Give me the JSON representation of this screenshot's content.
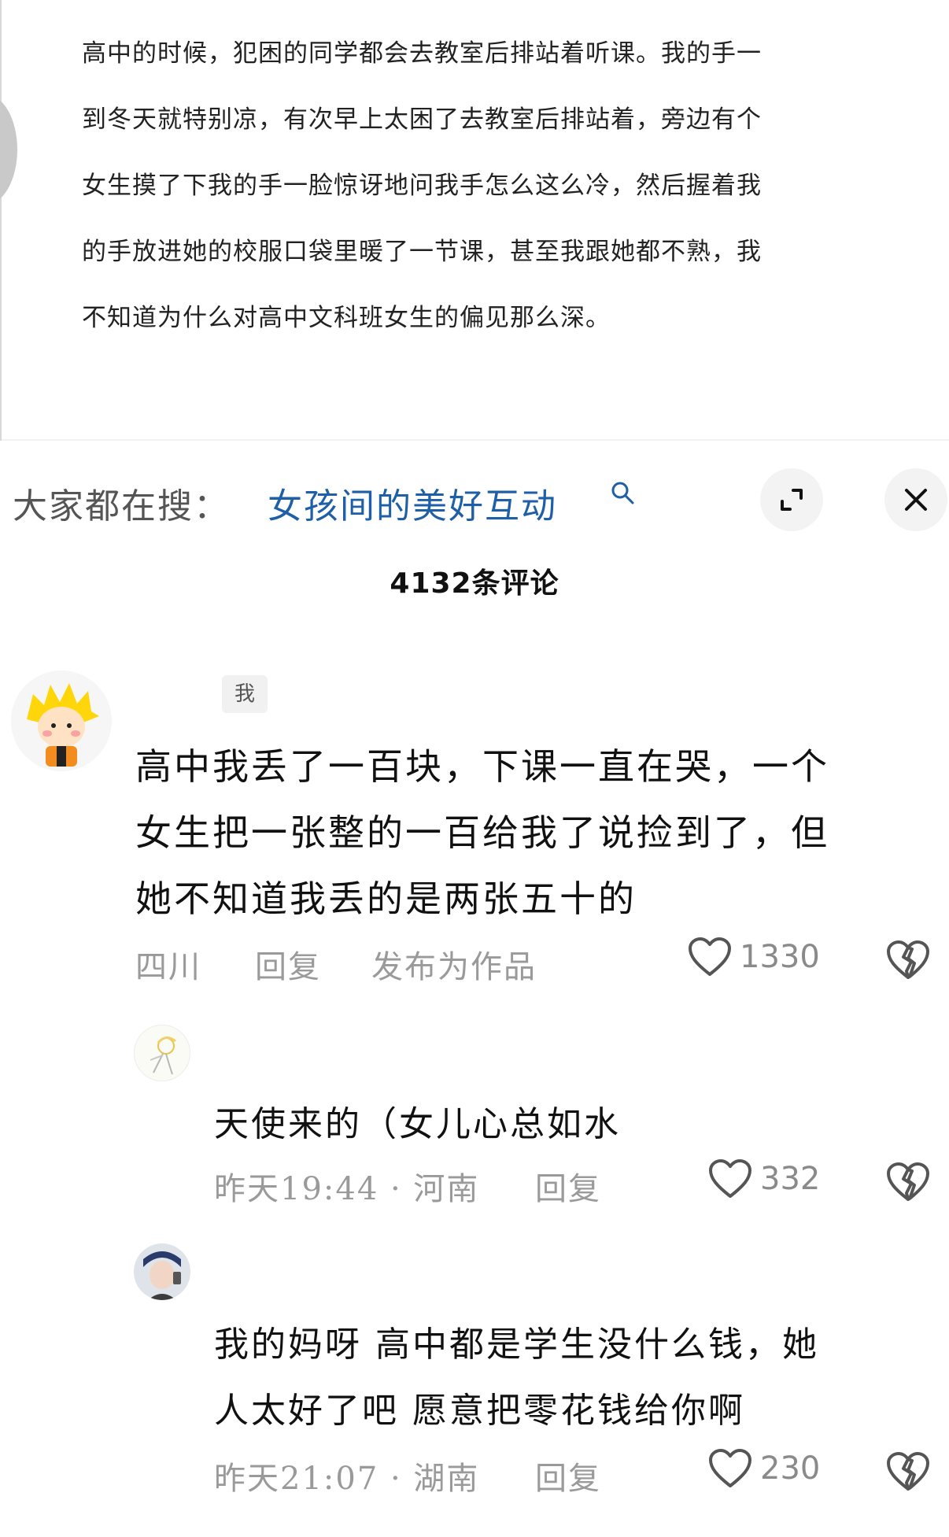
{
  "post": {
    "lines": [
      "高中的时候，犯困的同学都会去教室后排站着听课。我的手一",
      "到冬天就特别凉，有次早上太困了去教室后排站着，旁边有个",
      "女生摸了下我的手一脸惊讶地问我手怎么这么冷，然后握着我",
      "的手放进她的校服口袋里暖了一节课，甚至我跟她都不熟，我",
      "不知道为什么对高中文科班女生的偏见那么深。"
    ]
  },
  "search": {
    "prefix": "大家都在搜：",
    "term": "女孩间的美好互动",
    "icon": "search-icon"
  },
  "comments_header": {
    "count_label": "4132条评论"
  },
  "comments": [
    {
      "author_tag": "我",
      "avatar": "cartoon-avatar",
      "lines": [
        "高中我丢了一百块，下课一直在哭，一个",
        "女生把一张整的一百给我了说捡到了，但",
        "她不知道我丢的是两张五十的"
      ],
      "location": "四川",
      "reply_label": "回复",
      "publish_label": "发布为作品",
      "likes": "1330"
    },
    {
      "avatar": "sketch-avatar",
      "lines": [
        "天使来的（女儿心总如水"
      ],
      "time_location": "昨天19:44 · 河南",
      "reply_label": "回复",
      "likes": "332"
    },
    {
      "avatar": "photo-avatar",
      "lines": [
        "我的妈呀 高中都是学生没什么钱，她",
        "人太好了吧 愿意把零花钱给你啊"
      ],
      "time_location": "昨天21:07 · 湖南",
      "reply_label": "回复",
      "likes": "230"
    }
  ],
  "colors": {
    "search_term": "#1f5fa8",
    "meta_gray": "#9a9a9a"
  }
}
